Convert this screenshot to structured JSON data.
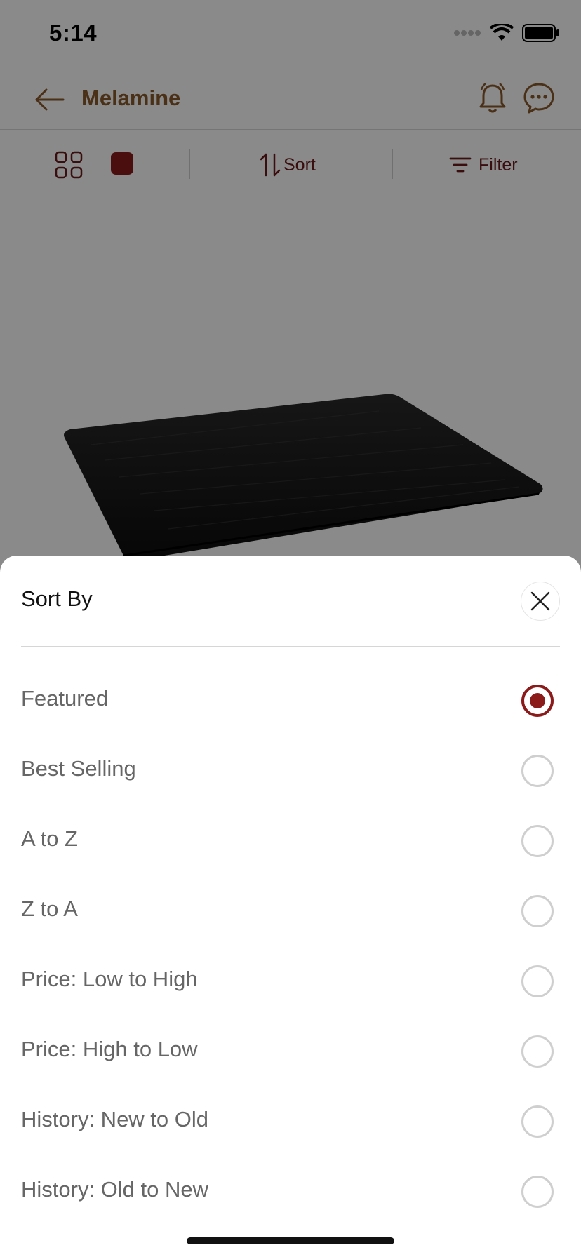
{
  "status_bar": {
    "time": "5:14"
  },
  "header": {
    "title": "Melamine"
  },
  "toolbar": {
    "sort_label": "Sort",
    "filter_label": "Filter"
  },
  "sort_sheet": {
    "title": "Sort By",
    "selected": "Featured",
    "options": [
      {
        "label": "Featured"
      },
      {
        "label": "Best Selling"
      },
      {
        "label": "A to Z"
      },
      {
        "label": "Z to A"
      },
      {
        "label": "Price: Low to High"
      },
      {
        "label": "Price: High to Low"
      },
      {
        "label": "History: New to Old"
      },
      {
        "label": "History: Old to New"
      }
    ]
  },
  "colors": {
    "brand": "#8b1a1a",
    "header_text": "#8a5a2b"
  }
}
